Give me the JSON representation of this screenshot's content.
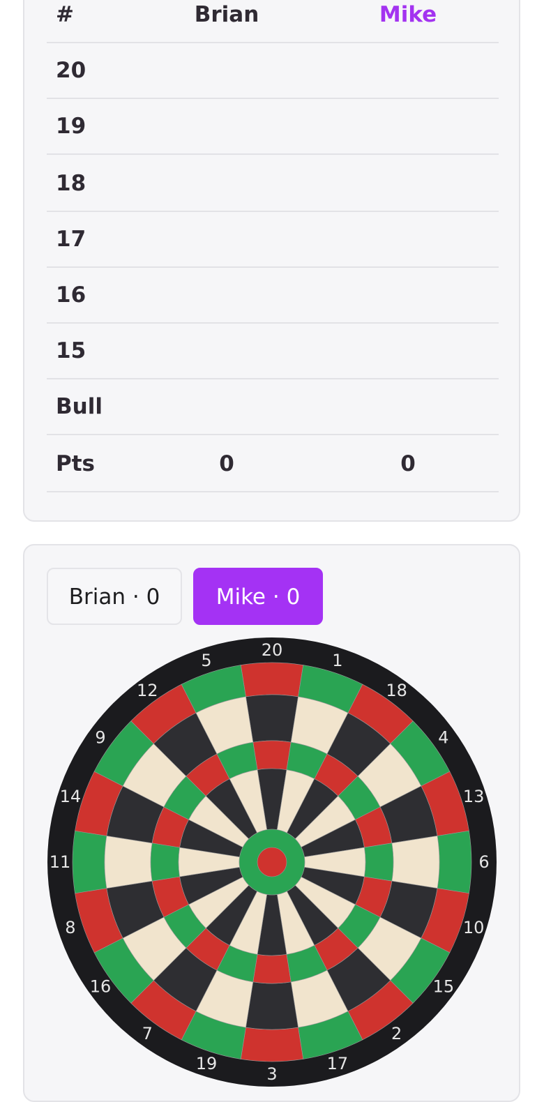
{
  "scoreboard": {
    "headers": [
      "#",
      "Brian",
      "Mike"
    ],
    "rows": [
      {
        "label": "20",
        "p1": "",
        "p2": ""
      },
      {
        "label": "19",
        "p1": "",
        "p2": ""
      },
      {
        "label": "18",
        "p1": "",
        "p2": ""
      },
      {
        "label": "17",
        "p1": "",
        "p2": ""
      },
      {
        "label": "16",
        "p1": "",
        "p2": ""
      },
      {
        "label": "15",
        "p1": "",
        "p2": ""
      },
      {
        "label": "Bull",
        "p1": "",
        "p2": ""
      },
      {
        "label": "Pts",
        "p1": "0",
        "p2": "0"
      }
    ],
    "active_color": "#a333f0"
  },
  "players": [
    {
      "name": "Brian",
      "separator": "·",
      "score": "0",
      "active": false
    },
    {
      "name": "Mike",
      "separator": "·",
      "score": "0",
      "active": true
    }
  ],
  "dartboard": {
    "numbers": [
      "20",
      "1",
      "18",
      "4",
      "13",
      "6",
      "10",
      "15",
      "2",
      "17",
      "3",
      "19",
      "7",
      "16",
      "8",
      "11",
      "14",
      "9",
      "12",
      "5"
    ],
    "colors": {
      "surround": "#1b1b1e",
      "dark": "#2e2e32",
      "light": "#f1e4cd",
      "red": "#cf332e",
      "green": "#2aa453",
      "number_text": "#e6e6e6"
    }
  }
}
